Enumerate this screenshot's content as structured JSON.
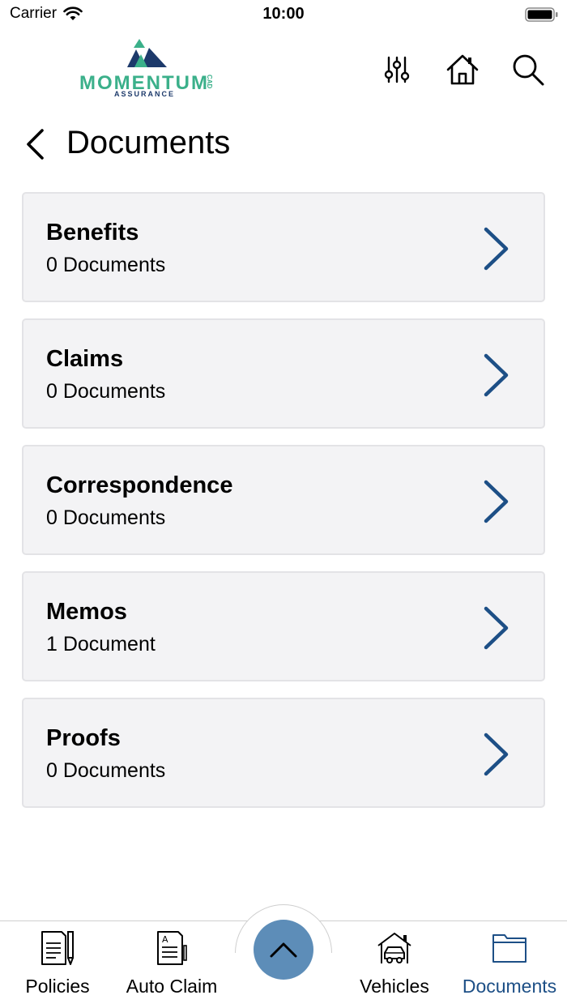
{
  "status_bar": {
    "carrier": "Carrier",
    "time": "10:00"
  },
  "header": {
    "logo_text": "MOMENTUM",
    "logo_sub": "ASSURANCE",
    "logo_cad": "CAD",
    "icons": [
      "sliders-icon",
      "home-icon",
      "search-icon"
    ]
  },
  "page": {
    "title": "Documents"
  },
  "documents": [
    {
      "name": "Benefits",
      "count": "0 Documents"
    },
    {
      "name": "Claims",
      "count": "0 Documents"
    },
    {
      "name": "Correspondence",
      "count": "0 Documents"
    },
    {
      "name": "Memos",
      "count": "1 Document"
    },
    {
      "name": "Proofs",
      "count": "0 Documents"
    }
  ],
  "tabs": [
    {
      "label": "Policies",
      "icon": "policy-pen-icon"
    },
    {
      "label": "Auto Claim",
      "icon": "claim-form-icon"
    },
    {
      "label": "Vehicles",
      "icon": "car-garage-icon"
    },
    {
      "label": "Documents",
      "icon": "folder-icon",
      "active": true
    }
  ],
  "colors": {
    "accent": "#1d4f86",
    "fab": "#5d8db8",
    "logo_green": "#3bb08a",
    "logo_navy": "#1d3a6b",
    "card_bg": "#f3f3f5"
  }
}
